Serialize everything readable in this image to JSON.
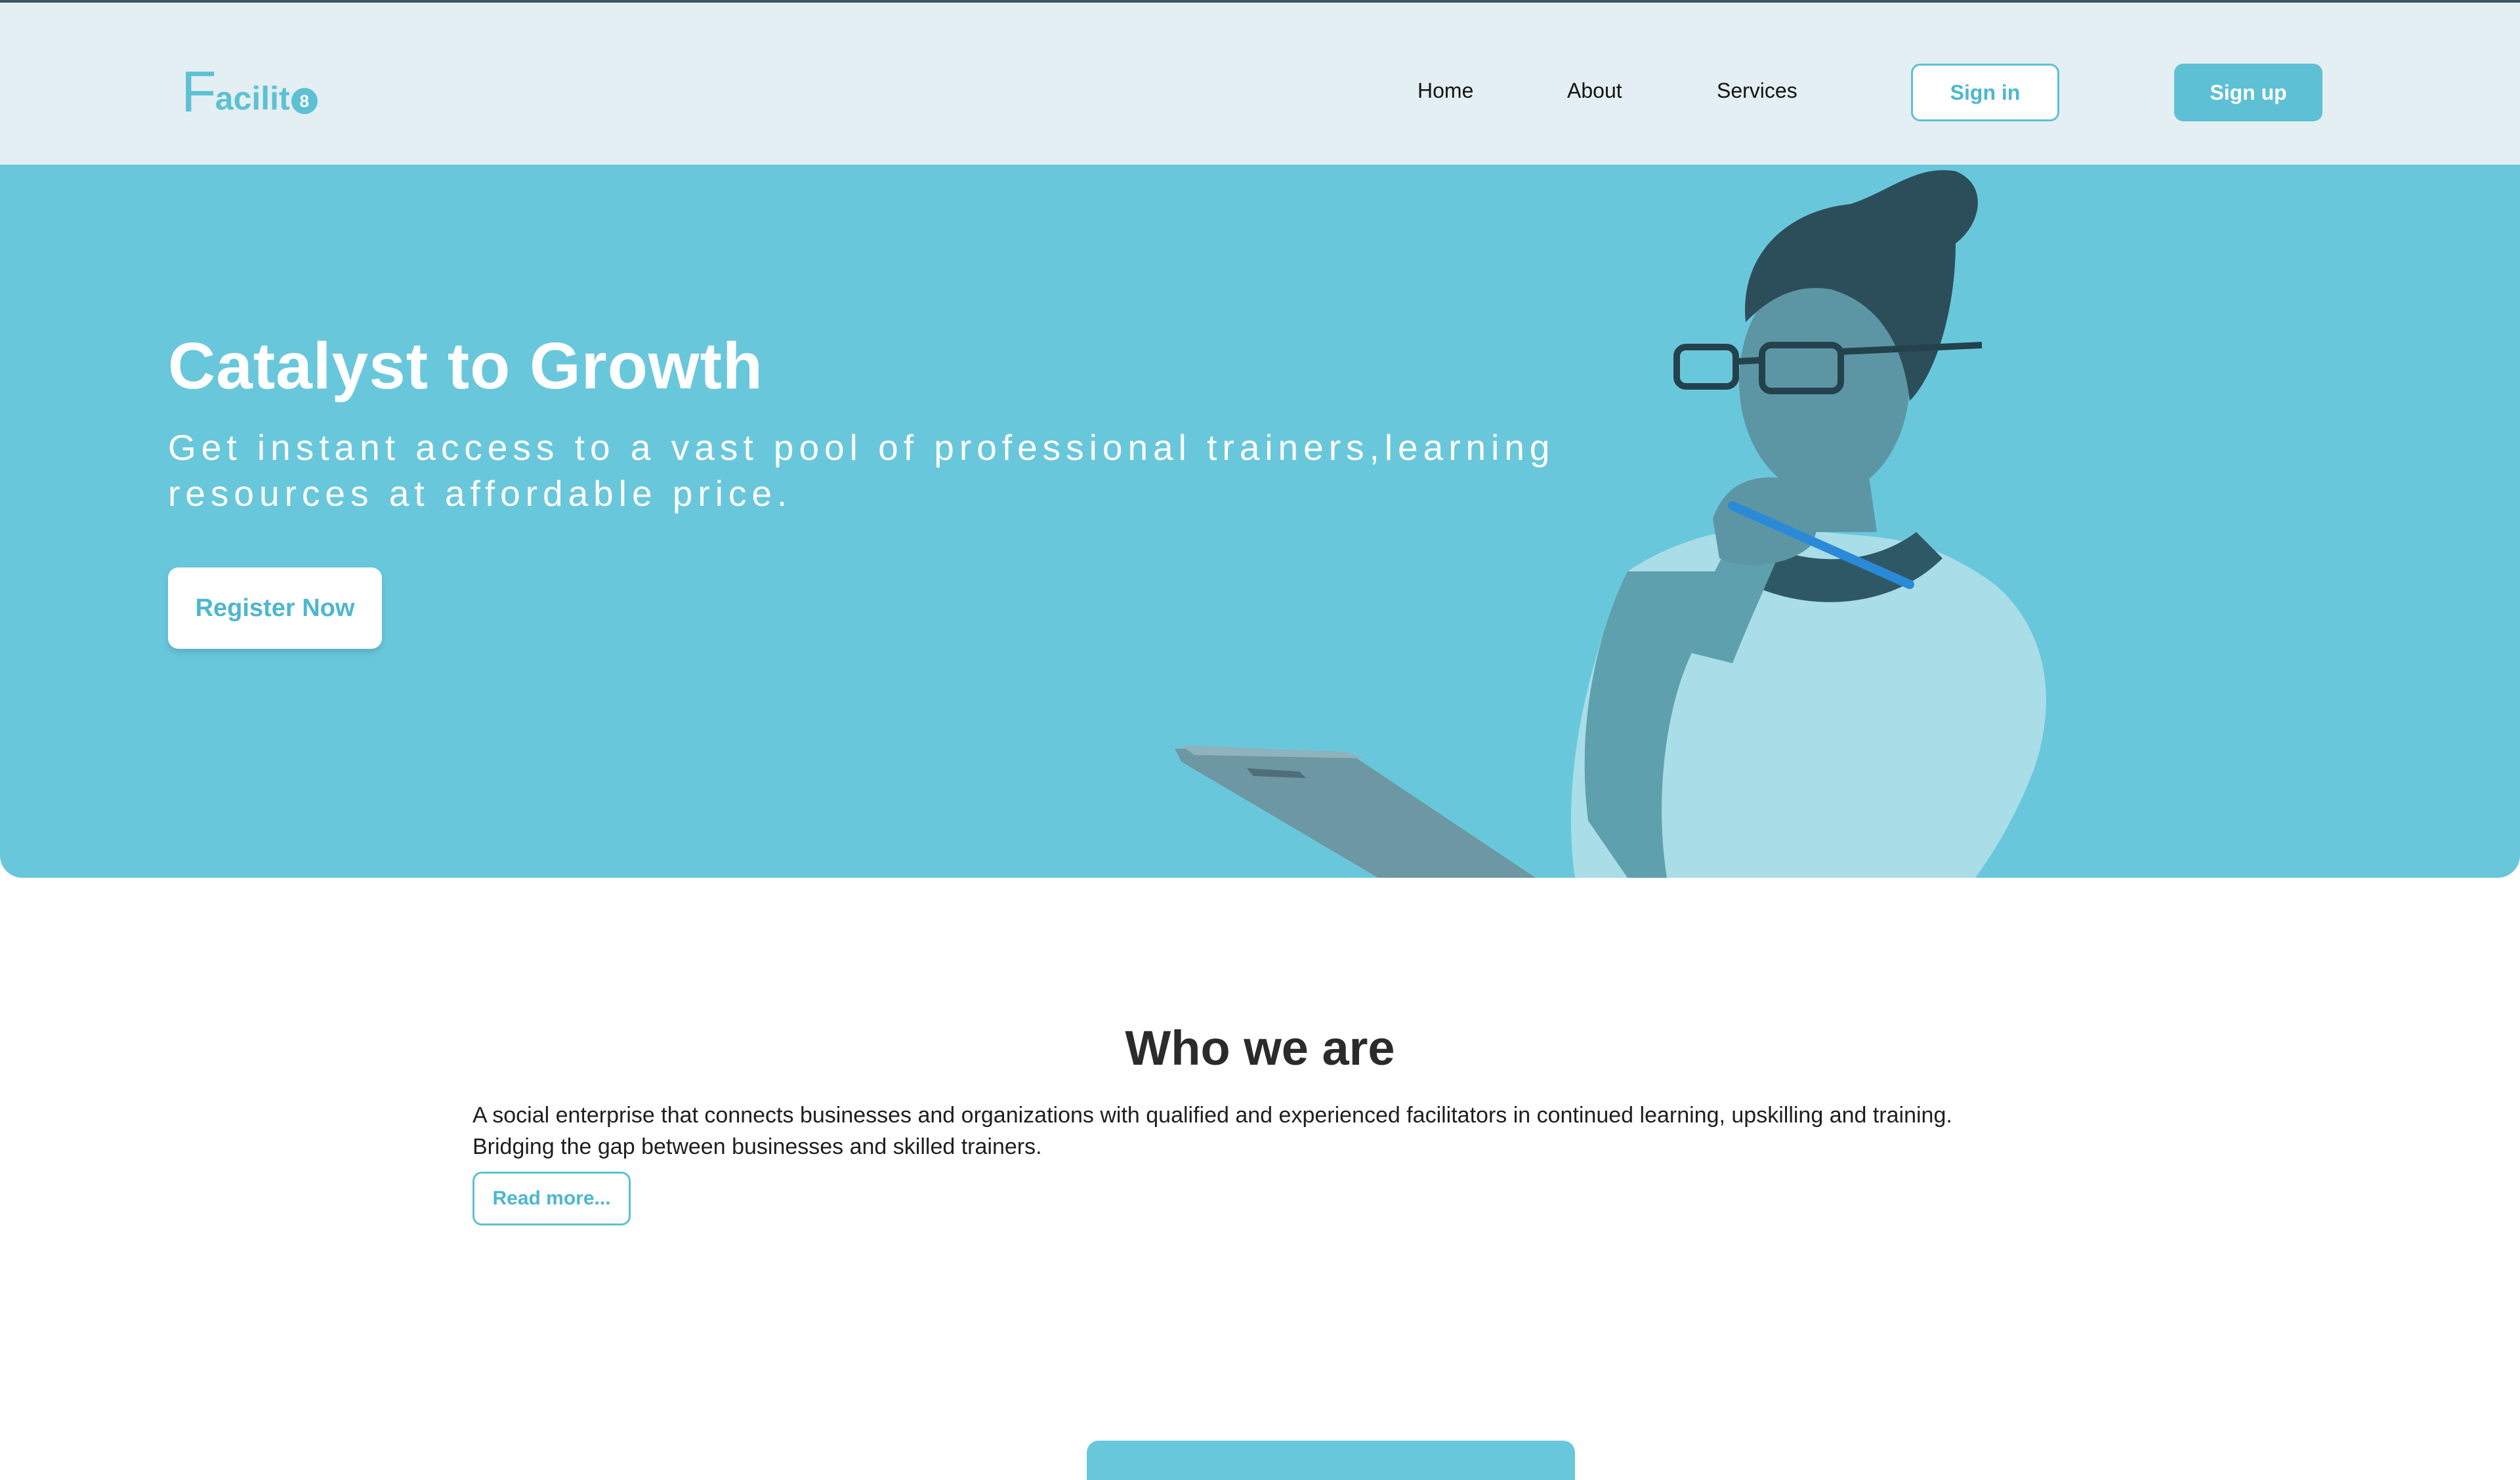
{
  "header": {
    "logo": {
      "first_letter": "F",
      "rest": "acilit",
      "badge": "8"
    },
    "nav": [
      {
        "label": "Home"
      },
      {
        "label": "About"
      },
      {
        "label": "Services"
      }
    ],
    "signin_label": "Sign in",
    "signup_label": "Sign up"
  },
  "hero": {
    "title": "Catalyst to Growth",
    "subtitle": "Get instant access to a vast pool of professional trainers,learning resources at affordable price.",
    "register_label": "Register Now"
  },
  "about": {
    "title": "Who we are",
    "body": "A social enterprise that connects businesses and organizations with qualified and experienced facilitators in continued learning, upskilling and training. Bridging the gap between businesses and skilled trainers.",
    "read_more_label": "Read more..."
  },
  "colors": {
    "accent": "#5ec0d4",
    "hero_bg": "#69c7dc",
    "header_bg": "#e3eff2",
    "text_dark": "#2b2b2b"
  }
}
